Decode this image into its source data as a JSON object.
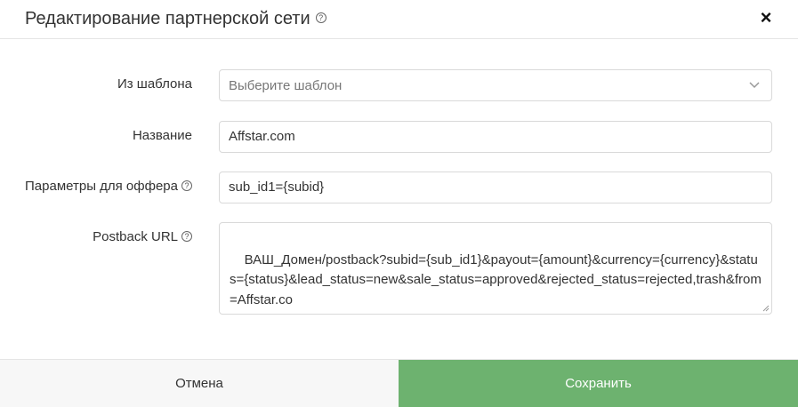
{
  "dialog": {
    "title": "Редактирование партнерской сети",
    "close_label": "×"
  },
  "form": {
    "template": {
      "label": "Из шаблона",
      "placeholder": "Выберите шаблон"
    },
    "name": {
      "label": "Название",
      "value": "Affstar.com"
    },
    "offer_params": {
      "label": "Параметры для оффера",
      "value": "sub_id1={subid}"
    },
    "postback_url": {
      "label": "Postback URL",
      "value": "ВАШ_Домен/postback?subid={sub_id1}&payout={amount}&currency={currency}&status={status}&lead_status=new&sale_status=approved&rejected_status=rejected,trash&from=Affstar.co"
    }
  },
  "footer": {
    "cancel_label": "Отмена",
    "save_label": "Сохранить"
  },
  "colors": {
    "save_button": "#6db26f",
    "cancel_button": "#f7f7f7"
  },
  "icons": {
    "help": "question-circle-icon",
    "close": "close-icon",
    "chevron": "chevron-down-icon"
  }
}
